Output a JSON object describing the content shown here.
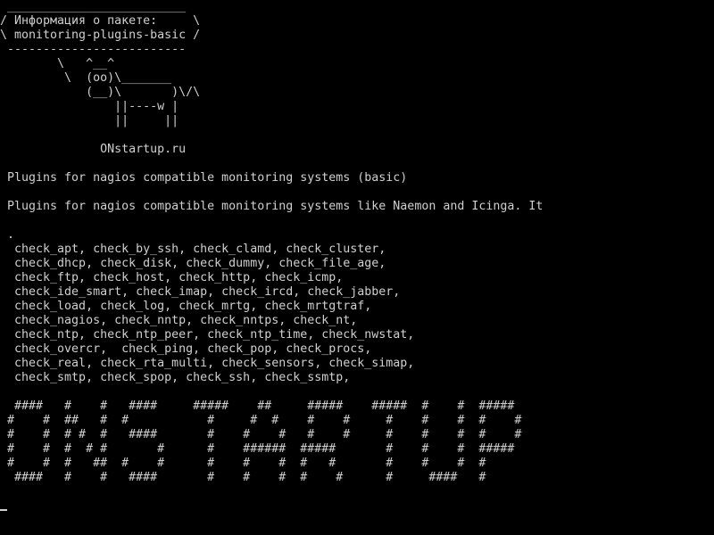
{
  "terminal": {
    "cowsay_art": " _________________________\n/ Информация о пакете:     \\\n\\ monitoring-plugins-basic /\n -------------------------\n        \\   ^__^\n         \\  (oo)\\_______\n            (__)\\       )\\/\\\n                ||----w |\n                ||     ||\n\n              ONstartup.ru",
    "summary": " Plugins for nagios compatible monitoring systems (basic)",
    "description": " Plugins for nagios compatible monitoring systems like Naemon and Icinga. It",
    "plugins_list": " .\n  check_apt, check_by_ssh, check_clamd, check_cluster,\n  check_dhcp, check_disk, check_dummy, check_file_age,\n  check_ftp, check_host, check_http, check_icmp,\n  check_ide_smart, check_imap, check_ircd, check_jabber,\n  check_load, check_log, check_mrtg, check_mrtgtraf,\n  check_nagios, check_nntp, check_nntps, check_nt,\n  check_ntp, check_ntp_peer, check_ntp_time, check_nwstat,\n  check_overcr,  check_ping, check_pop, check_procs,\n  check_real, check_rta_multi, check_sensors, check_simap,\n  check_smtp, check_spop, check_ssh, check_ssmtp,",
    "banner_art": "  ####   #    #   ####     #####    ##     #####    #####  #    #  #####\n #    #  ##   #  #           #     #  #    #    #     #    #    #  #    #\n #    #  # #  #   ####       #    #    #   #    #     #    #    #  #    #\n #    #  #  # #       #      #    ######  #####       #    #    #  #####\n #    #  #   ##  #    #      #    #    #  #   #       #    #    #  #\n  ####   #    #   ####       #    #    #  #    #      #     ####   #"
  }
}
